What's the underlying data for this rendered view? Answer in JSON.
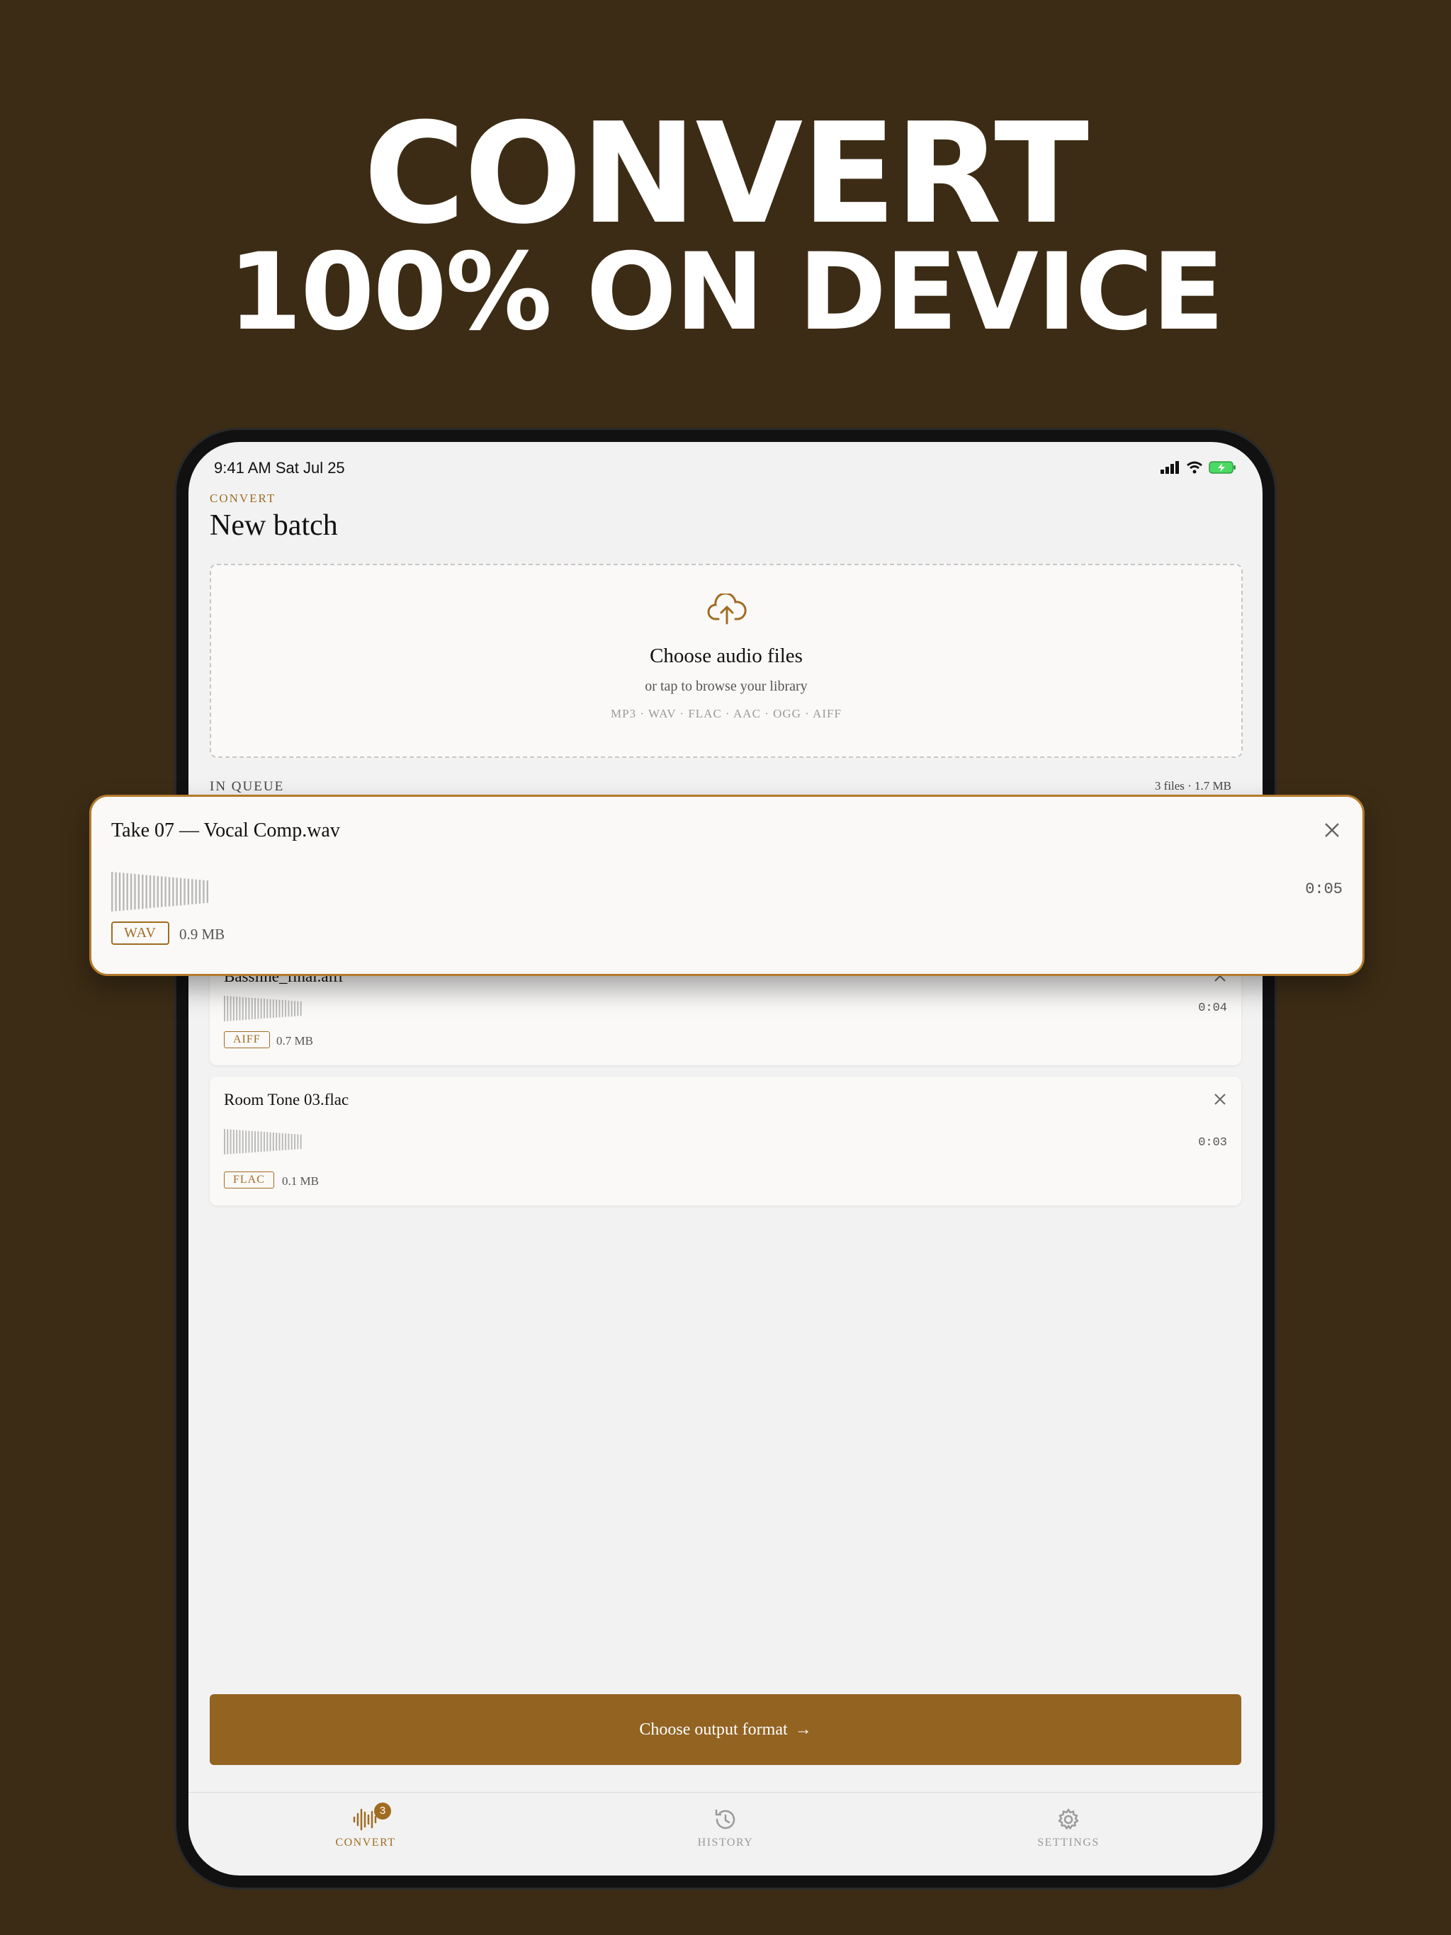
{
  "headline": {
    "line1": "CONVERT",
    "line2": "100% ON DEVICE"
  },
  "status": {
    "time": "9:41 AM   Sat Jul 25"
  },
  "header": {
    "eyebrow": "CONVERT",
    "title": "New batch"
  },
  "dropzone": {
    "title": "Choose audio files",
    "subtitle": "or tap to browse your library",
    "formats": "MP3 · WAV · FLAC · AAC · OGG · AIFF"
  },
  "queue": {
    "label": "IN QUEUE",
    "meta": "3 files · 1.7 MB",
    "items": [
      {
        "name": "Take 07 — Vocal Comp.wav",
        "duration": "0:05",
        "format": "WAV",
        "size": "0.9 MB"
      },
      {
        "name": "Bassline_final.aiff",
        "duration": "0:04",
        "format": "AIFF",
        "size": "0.7 MB"
      },
      {
        "name": "Room Tone 03.flac",
        "duration": "0:03",
        "format": "FLAC",
        "size": "0.1 MB"
      }
    ]
  },
  "cta": {
    "label": "Choose output format",
    "arrow": "→"
  },
  "tabs": [
    {
      "label": "CONVERT",
      "icon": "waveform-icon",
      "badge": "3",
      "active": true
    },
    {
      "label": "HISTORY",
      "icon": "history-icon"
    },
    {
      "label": "SETTINGS",
      "icon": "gear-icon"
    }
  ],
  "colors": {
    "background": "#3c2c15",
    "accent": "#a06c22",
    "button": "#936322",
    "screen": "#f2f2f2",
    "card": "#faf9f7"
  }
}
